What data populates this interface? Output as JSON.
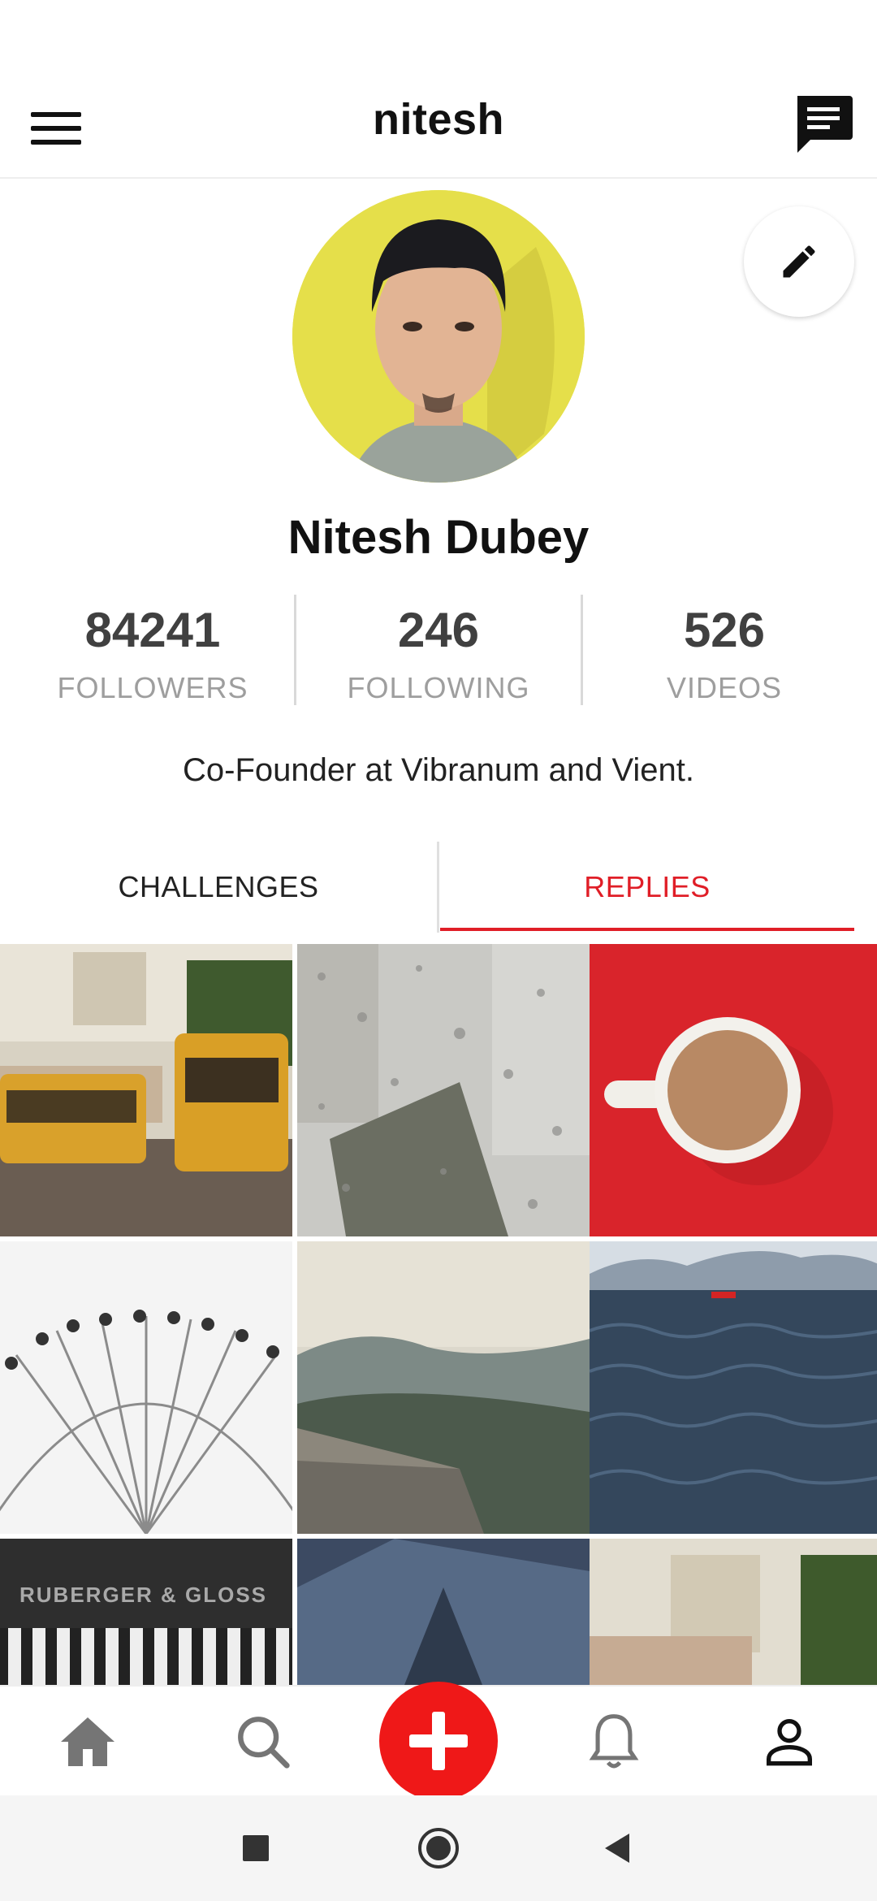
{
  "appbar": {
    "title": "nitesh",
    "menu_icon": "hamburger-menu-icon",
    "chat_icon": "chat-message-icon"
  },
  "profile": {
    "name": "Nitesh Dubey",
    "bio": "Co-Founder at Vibranum and Vient.",
    "edit_icon": "pencil-icon"
  },
  "stats": [
    {
      "value": "84241",
      "label": "FOLLOWERS"
    },
    {
      "value": "246",
      "label": "FOLLOWING"
    },
    {
      "value": "526",
      "label": "VIDEOS"
    }
  ],
  "tabs": [
    {
      "label": "CHALLENGES",
      "active": false
    },
    {
      "label": "REPLIES",
      "active": true
    }
  ],
  "grid": [
    {
      "subject": "yellow trams on street"
    },
    {
      "subject": "raindrops on window"
    },
    {
      "subject": "coffee cup on red"
    },
    {
      "subject": "ferris wheel"
    },
    {
      "subject": "mountain landscape"
    },
    {
      "subject": "sea waves with boat"
    },
    {
      "subject": "piano keys",
      "text": "RUBERGER & GLOSS"
    },
    {
      "subject": "rocky mountainside"
    },
    {
      "subject": "trams and church"
    }
  ],
  "bottom_nav": [
    {
      "icon": "home-icon"
    },
    {
      "icon": "search-icon"
    },
    {
      "icon": "add-icon"
    },
    {
      "icon": "bell-icon"
    },
    {
      "icon": "profile-icon"
    }
  ],
  "colors": {
    "accent": "#e01e27",
    "add_button": "#ef1818",
    "stat_number": "#404040",
    "stat_label": "#9e9e9e"
  }
}
